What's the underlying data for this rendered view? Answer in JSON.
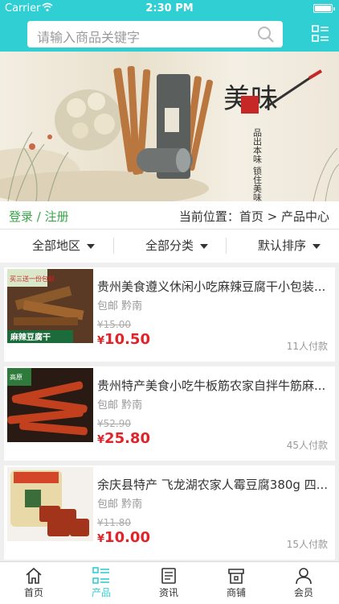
{
  "status_bar": {
    "carrier": "Carrier",
    "time": "2:30 PM"
  },
  "search": {
    "placeholder": "请输入商品关键字"
  },
  "breadcrumb": {
    "login": "登录 / 注册",
    "location": "当前位置：首页 > 产品中心"
  },
  "banner": {
    "brand_big": "美味",
    "side_text": "品出本味 锁住美味"
  },
  "filters": [
    {
      "label": "全部地区"
    },
    {
      "label": "全部分类"
    },
    {
      "label": "默认排序"
    }
  ],
  "products": [
    {
      "title": "贵州美食遵义休闲小吃麻辣豆腐干小包装...",
      "region": "包邮 黔南",
      "old_price": "¥15.00",
      "price_symbol": "¥",
      "price": "10.50",
      "sold": "11人付款",
      "thumb_label": "麻辣豆腐干",
      "thumb_tag": "买三送一份包邮"
    },
    {
      "title": "贵州特产美食小吃牛板筋农家自拌牛筋麻...",
      "region": "包邮 黔南",
      "old_price": "¥52.90",
      "price_symbol": "¥",
      "price": "25.80",
      "sold": "45人付款",
      "thumb_tag": "高原"
    },
    {
      "title": "余庆县特产 飞龙湖农家人霉豆腐380g 四...",
      "region": "包邮 黔南",
      "old_price": "¥11.80",
      "price_symbol": "¥",
      "price": "10.00",
      "sold": "15人付款"
    }
  ],
  "tabbar": [
    {
      "label": "首页",
      "icon": "home-icon"
    },
    {
      "label": "产品",
      "icon": "list-icon"
    },
    {
      "label": "资讯",
      "icon": "news-icon"
    },
    {
      "label": "商铺",
      "icon": "shop-icon"
    },
    {
      "label": "会员",
      "icon": "user-icon"
    }
  ],
  "colors": {
    "accent": "#2fcfd4",
    "price": "#e0242a",
    "login": "#3aa64a"
  }
}
